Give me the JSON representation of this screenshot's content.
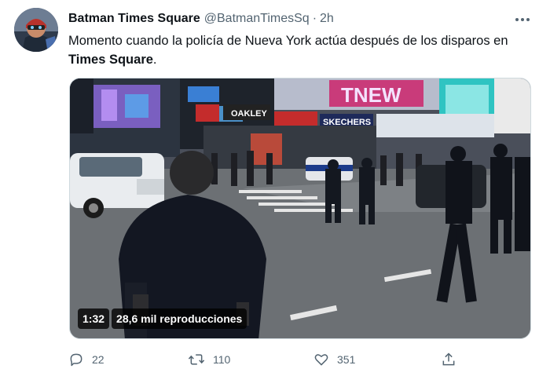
{
  "tweet": {
    "author": {
      "display_name": "Batman Times Square",
      "handle": "@BatmanTimesSq",
      "separator": "·",
      "time": "2h"
    },
    "text_before": "Momento cuando la policía de Nueva York actúa después de los disparos en ",
    "text_bold": "Times Square",
    "text_after": ".",
    "media": {
      "duration": "1:32",
      "views": "28,6 mil reproducciones",
      "signs": {
        "oakley": "OAKLEY",
        "skechers": "SKECHERS",
        "neon": "TNEW"
      }
    },
    "actions": {
      "replies": "22",
      "retweets": "110",
      "likes": "351"
    },
    "icons": {
      "more": "more-dots-icon",
      "reply": "reply-icon",
      "retweet": "retweet-icon",
      "like": "heart-icon",
      "share": "share-icon"
    },
    "colors": {
      "text": "#0f1419",
      "secondary": "#536471",
      "border": "#cfd9de"
    }
  }
}
